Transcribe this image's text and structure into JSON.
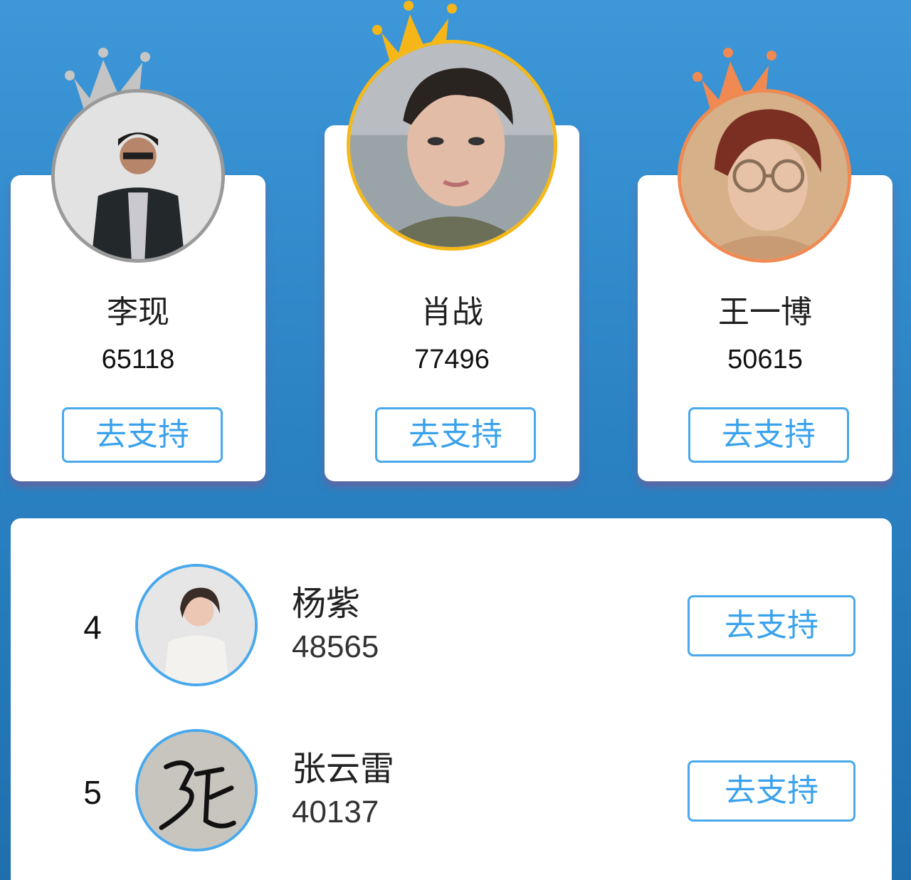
{
  "podium": [
    {
      "rank": 2,
      "name": "李现",
      "score": "65118",
      "button": "去支持",
      "medal_color": "#9a9a9a",
      "avatar": "male-in-black-jacket"
    },
    {
      "rank": 1,
      "name": "肖战",
      "score": "77496",
      "button": "去支持",
      "medal_color": "#f5b819",
      "avatar": "male-portrait"
    },
    {
      "rank": 3,
      "name": "王一博",
      "score": "50615",
      "button": "去支持",
      "medal_color": "#f08a52",
      "avatar": "male-with-glasses"
    }
  ],
  "list": [
    {
      "rank": "4",
      "name": "杨紫",
      "score": "48565",
      "button": "去支持",
      "avatar": "female-portrait"
    },
    {
      "rank": "5",
      "name": "张云雷",
      "score": "40137",
      "button": "去支持",
      "avatar": "calligraphy-zhang"
    }
  ],
  "colors": {
    "accent": "#3aa2ec",
    "background": "#2c84c5",
    "gold": "#f5b819",
    "silver": "#9a9a9a",
    "bronze": "#f08a52"
  }
}
